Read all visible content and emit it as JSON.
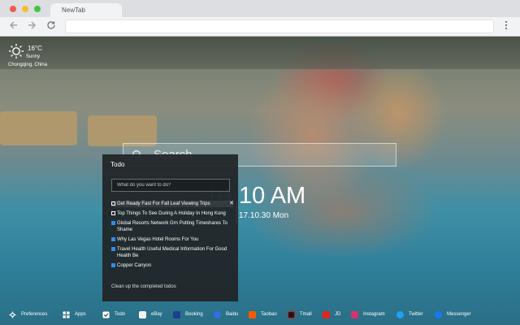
{
  "browser": {
    "tab_title": "NewTab",
    "nav": {
      "back_icon": "arrow-left-icon",
      "forward_icon": "arrow-right-icon",
      "reload_icon": "reload-icon",
      "menu_icon": "kebab-menu-icon"
    }
  },
  "weather": {
    "temperature": "16°C",
    "condition": "Sunny",
    "location": "Chongqing,  China",
    "icon": "sun-icon"
  },
  "search": {
    "placeholder": "Search"
  },
  "clock": {
    "ghost": "10",
    "time": "10 AM",
    "date": "17.10.30 Mon"
  },
  "todo": {
    "title": "Todo",
    "input_placeholder": "What do you want to do?",
    "items": [
      {
        "text": "Get Ready Fast For Fall Leaf Viewing Trips",
        "done": false
      },
      {
        "text": "Top Things To See During A Holiday In Hong Kong",
        "done": false
      },
      {
        "text": "Global Resorts Network Grn Putting Timeshares To Shame",
        "done": true
      },
      {
        "text": "Why Las Vegas Hotel Rooms For You",
        "done": true
      },
      {
        "text": "Travel Health Useful Medical Information For Good Health Be",
        "done": true
      },
      {
        "text": "Copper Canyon",
        "done": true
      }
    ],
    "delete_icon": "close-icon",
    "clean_label": "Clean up the completed todos"
  },
  "bottom_bar": [
    {
      "label": "Preferences",
      "icon": "gear-icon",
      "color": "#ffffff"
    },
    {
      "label": "Apps",
      "icon": "grid-icon",
      "color": "#ffffff"
    },
    {
      "label": "Todo",
      "icon": "checkbox-icon",
      "color": "#ffffff"
    },
    {
      "label": "eBay",
      "icon": "ebay-icon",
      "color": "#f2f2f2"
    },
    {
      "label": "Booking",
      "icon": "booking-icon",
      "color": "#1e3f8f"
    },
    {
      "label": "Baidu",
      "icon": "baidu-icon",
      "color": "#2e6fe6"
    },
    {
      "label": "Taobao",
      "icon": "taobao-icon",
      "color": "#ff5a00"
    },
    {
      "label": "Tmall",
      "icon": "tmall-icon",
      "color": "#1a1a1a"
    },
    {
      "label": "JD",
      "icon": "jd-icon",
      "color": "#e1251b"
    },
    {
      "label": "Instagram",
      "icon": "instagram-icon",
      "color": "#d6336c"
    },
    {
      "label": "Twitter",
      "icon": "twitter-icon",
      "color": "#1da1f2"
    },
    {
      "label": "Messenger",
      "icon": "messenger-icon",
      "color": "#1877f2"
    }
  ]
}
